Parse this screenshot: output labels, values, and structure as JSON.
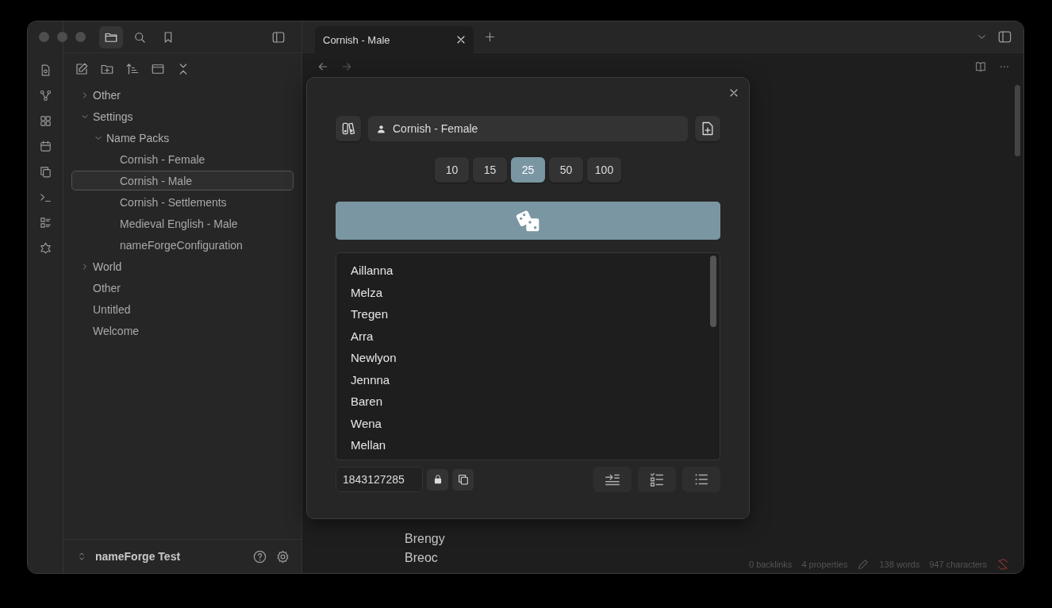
{
  "sidebar": {
    "tree": [
      {
        "label": "Other",
        "kind": "folder",
        "expanded": false,
        "selected": false
      },
      {
        "label": "Settings",
        "kind": "folder",
        "expanded": true,
        "selected": false,
        "children": [
          {
            "label": "Name Packs",
            "kind": "folder",
            "expanded": true,
            "selected": false,
            "children": [
              {
                "label": "Cornish - Female",
                "kind": "file",
                "selected": false
              },
              {
                "label": "Cornish - Male",
                "kind": "file",
                "selected": true
              },
              {
                "label": "Cornish - Settlements",
                "kind": "file",
                "selected": false
              },
              {
                "label": "Medieval English - Male",
                "kind": "file",
                "selected": false
              },
              {
                "label": "nameForgeConfiguration",
                "kind": "file",
                "selected": false
              }
            ]
          }
        ]
      },
      {
        "label": "World",
        "kind": "folder",
        "expanded": false,
        "selected": false
      },
      {
        "label": "Other",
        "kind": "file",
        "selected": false
      },
      {
        "label": "Untitled",
        "kind": "file",
        "selected": false
      },
      {
        "label": "Welcome",
        "kind": "file",
        "selected": false
      }
    ],
    "vault": "nameForge Test"
  },
  "tabs": [
    {
      "label": "Cornish - Male",
      "selected": true
    }
  ],
  "document": {
    "lines": [
      "Brengy",
      "Breoc"
    ]
  },
  "status_bar": {
    "backlinks": "0 backlinks",
    "properties": "4 properties",
    "words": "138 words",
    "characters": "947 characters"
  },
  "dialog": {
    "pack": "Cornish - Female",
    "counts": [
      {
        "label": "10",
        "selected": false
      },
      {
        "label": "15",
        "selected": false
      },
      {
        "label": "25",
        "selected": true
      },
      {
        "label": "50",
        "selected": false
      },
      {
        "label": "100",
        "selected": false
      }
    ],
    "names": [
      "Aillanna",
      "Melza",
      "Tregen",
      "Arra",
      "Newlyon",
      "Jennna",
      "Baren",
      "Wena",
      "Mellan"
    ],
    "seed": "1843127285"
  }
}
